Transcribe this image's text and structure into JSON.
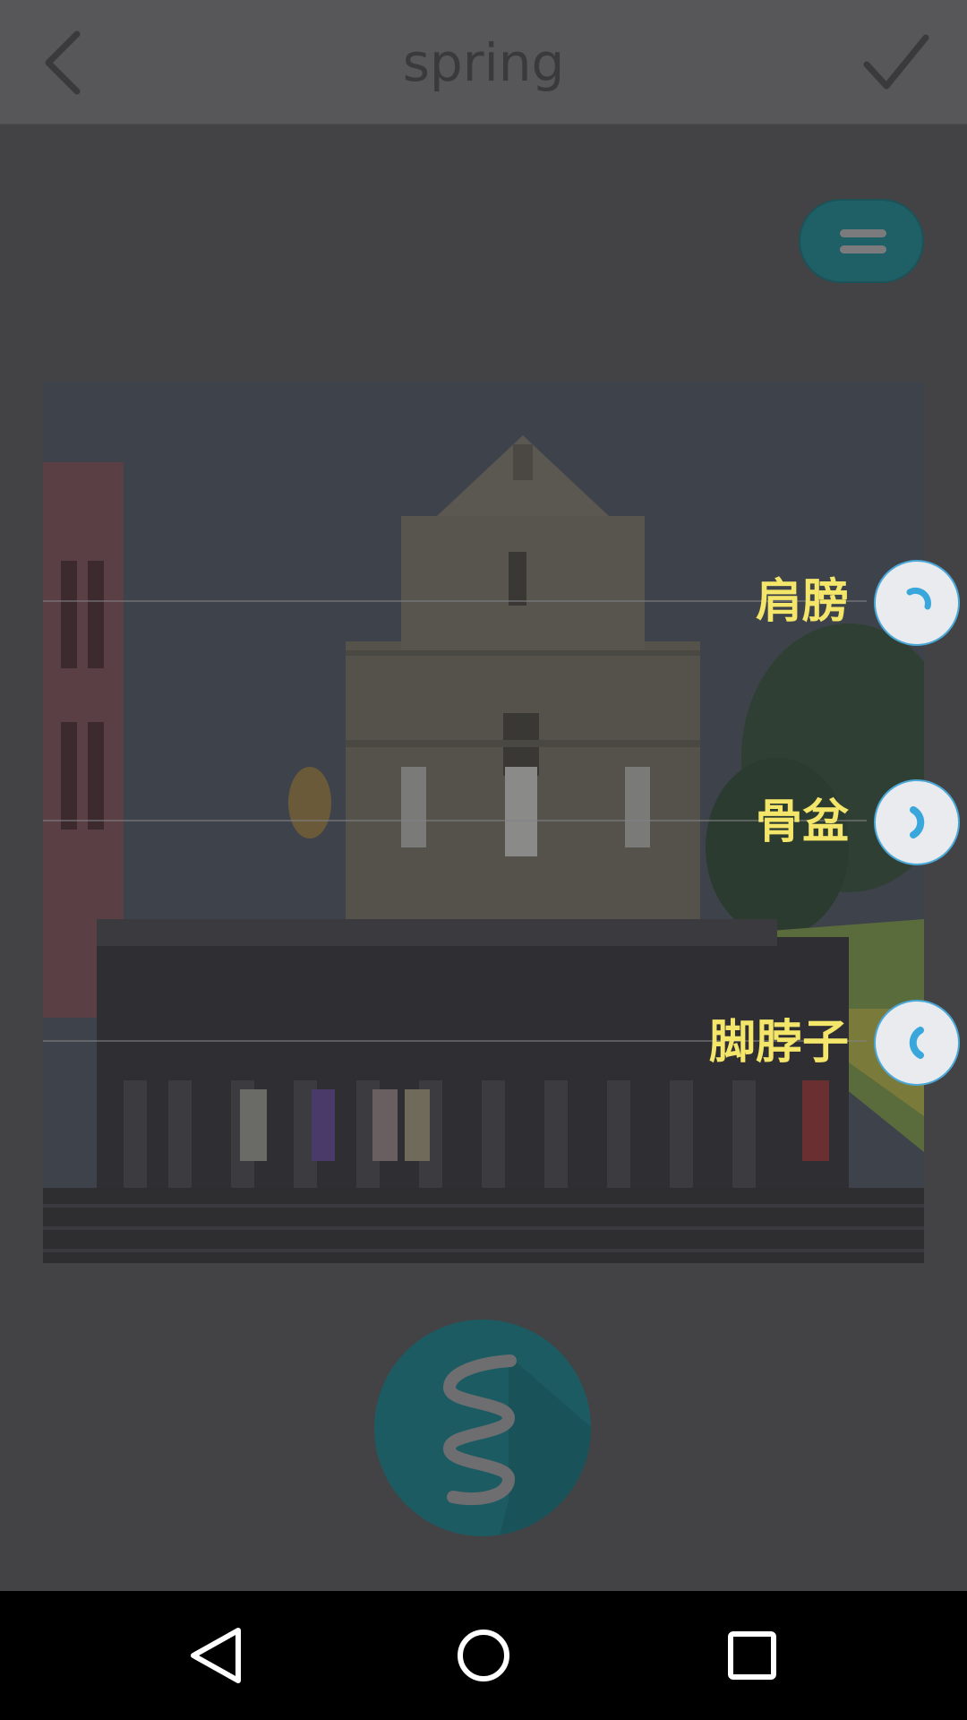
{
  "header": {
    "title": "spring"
  },
  "markers": [
    {
      "label": "肩膀",
      "rotation_icon": "rotate-clockwise-icon"
    },
    {
      "label": "骨盆",
      "rotation_icon": "arc-right-icon"
    },
    {
      "label": "脚脖子",
      "rotation_icon": "arc-left-icon"
    }
  ],
  "colors": {
    "accent": "#1d5b63",
    "label": "#f4e66a",
    "handle_stroke": "#4aa8d8",
    "handle_fill": "#e9ebee"
  },
  "icons": {
    "back": "chevron-left-icon",
    "confirm": "checkmark-icon",
    "menu": "menu-icon",
    "spring": "spring-coil-icon",
    "nav_back": "triangle-back-icon",
    "nav_home": "circle-home-icon",
    "nav_recents": "square-recents-icon"
  }
}
